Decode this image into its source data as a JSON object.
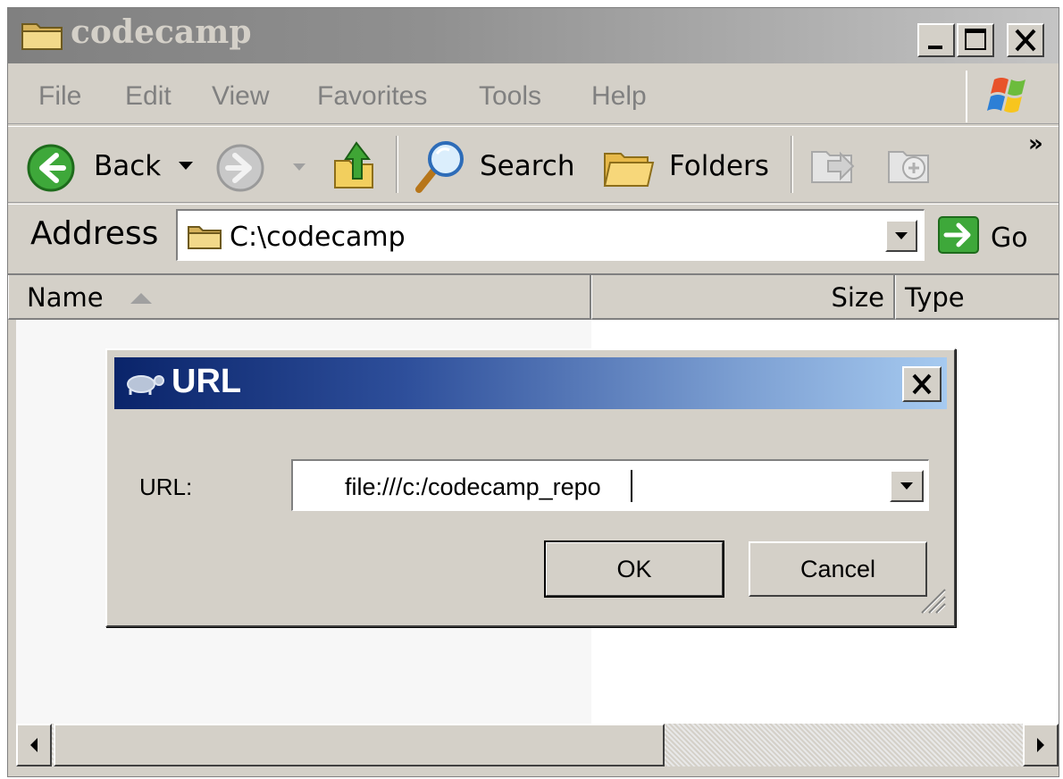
{
  "window": {
    "title": "codecamp",
    "icon": "folder-icon",
    "controls": {
      "minimize": "minimize-icon",
      "maximize": "maximize-icon",
      "close": "close-icon"
    }
  },
  "menubar": {
    "items": [
      "File",
      "Edit",
      "View",
      "Favorites",
      "Tools",
      "Help"
    ],
    "logo": "windows-logo-icon"
  },
  "toolbar": {
    "back_label": "Back",
    "search_label": "Search",
    "folders_label": "Folders",
    "overflow": "»"
  },
  "addressbar": {
    "label": "Address",
    "path": "C:\\codecamp",
    "go_label": "Go"
  },
  "list": {
    "columns": [
      {
        "label": "Name",
        "sort": "ascending"
      },
      {
        "label": "Size"
      },
      {
        "label": "Type"
      }
    ]
  },
  "dialog": {
    "title": "URL",
    "url_label": "URL:",
    "url_value": "file:///c:/codecamp_repo",
    "ok_label": "OK",
    "cancel_label": "Cancel"
  },
  "colors": {
    "face": "#d4d0c8",
    "dialog_title_start": "#0a246a",
    "dialog_title_end": "#a6caf0",
    "inactive_title": "#808080"
  }
}
